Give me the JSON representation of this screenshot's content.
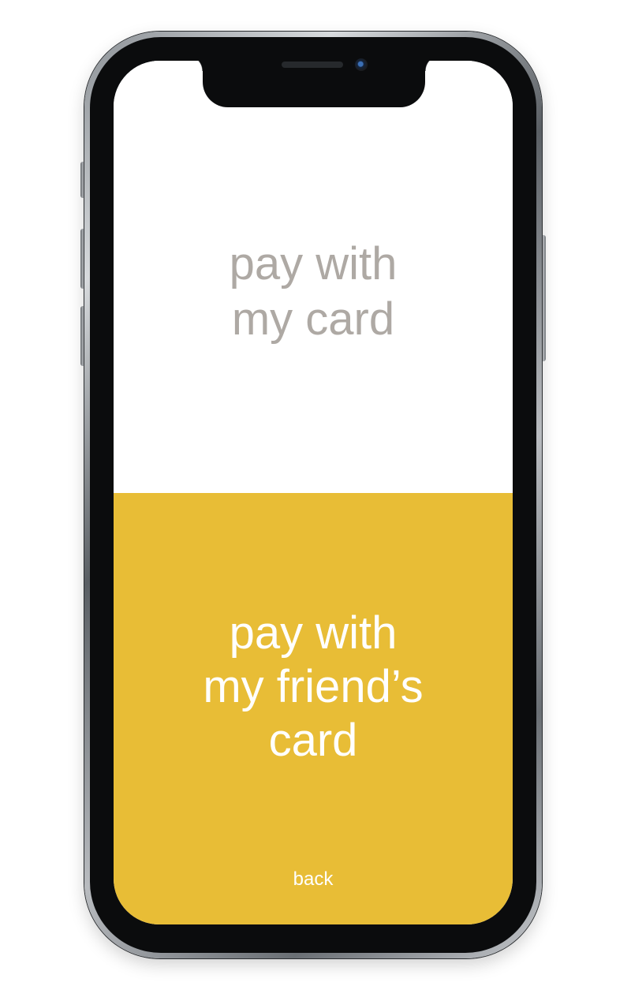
{
  "screen": {
    "option_my_card": {
      "label_line1": "pay with",
      "label_line2": "my card"
    },
    "option_friends_card": {
      "label_line1": "pay with",
      "label_line2": "my friend’s",
      "label_line3": "card"
    },
    "back_label": "back"
  },
  "colors": {
    "accent_yellow": "#e8bd36",
    "muted_text_gray": "#aea9a4",
    "screen_white": "#ffffff",
    "bezel_black": "#0b0c0d"
  },
  "device": {
    "type": "smartphone-mockup"
  }
}
